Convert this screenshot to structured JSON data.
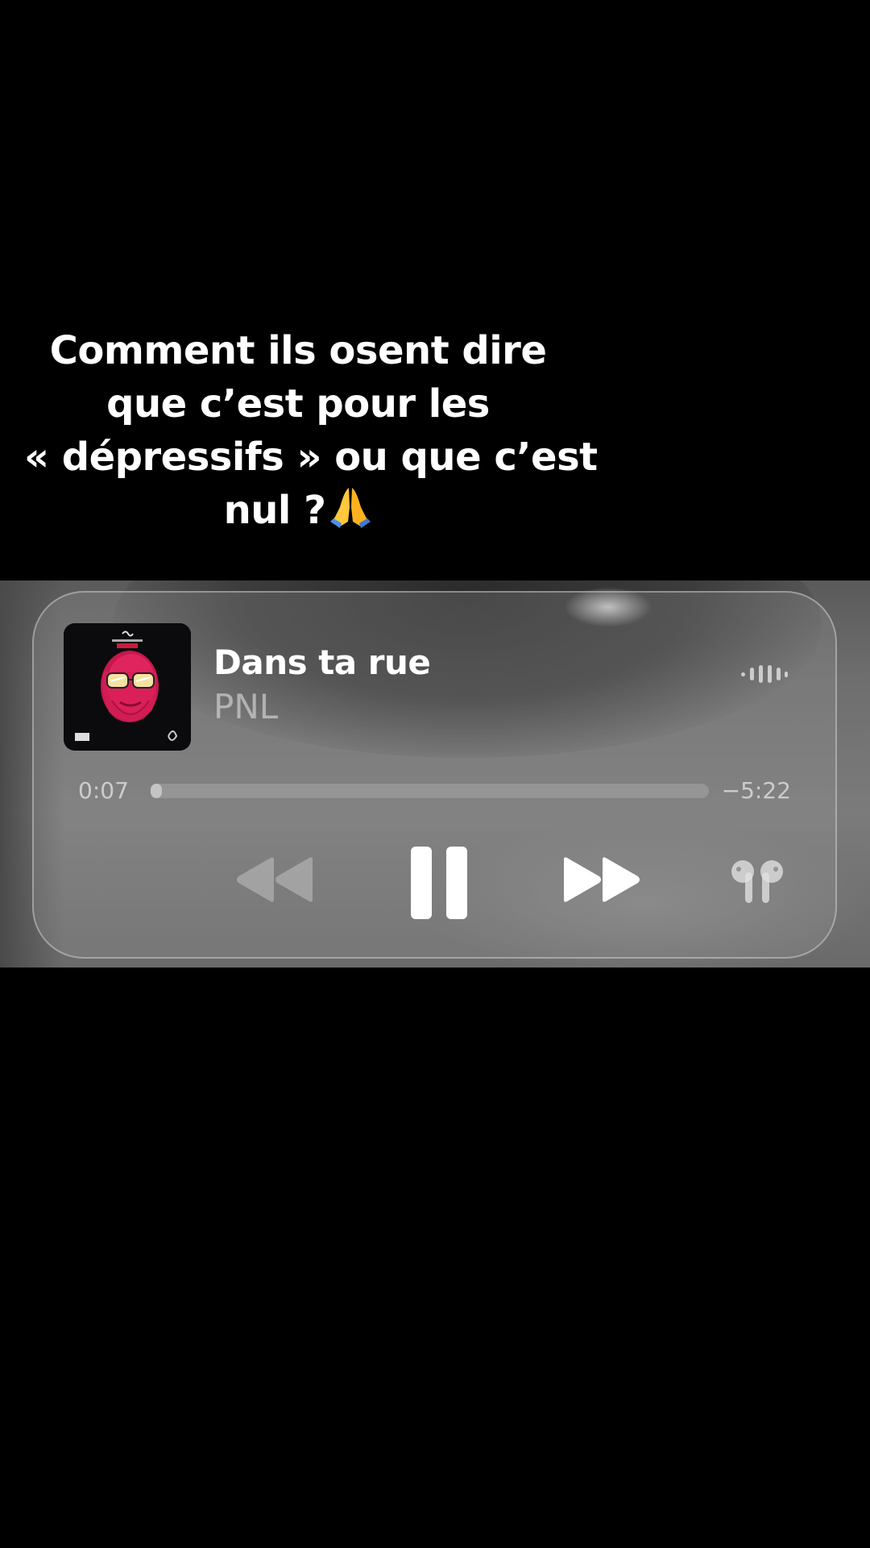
{
  "caption": {
    "line1": "Comment ils osent dire",
    "line2": "que c’est pour les",
    "line3": "« dépressifs » ou que c’est",
    "line4": "nul ?",
    "emoji": "🙏"
  },
  "player": {
    "track_title": "Dans ta rue",
    "artist": "PNL",
    "elapsed": "0:07",
    "remaining": "−5:22",
    "progress_fraction": 0.02,
    "icons": {
      "artwork": "album-artwork",
      "waveform": "audio-waveform-icon",
      "rewind": "rewind-icon",
      "pause": "pause-icon",
      "forward": "fast-forward-icon",
      "output": "airpods-icon"
    }
  },
  "colors": {
    "background": "#000000",
    "artwork_face": "#e0245e",
    "artwork_glasses": "#f3e3a0"
  }
}
